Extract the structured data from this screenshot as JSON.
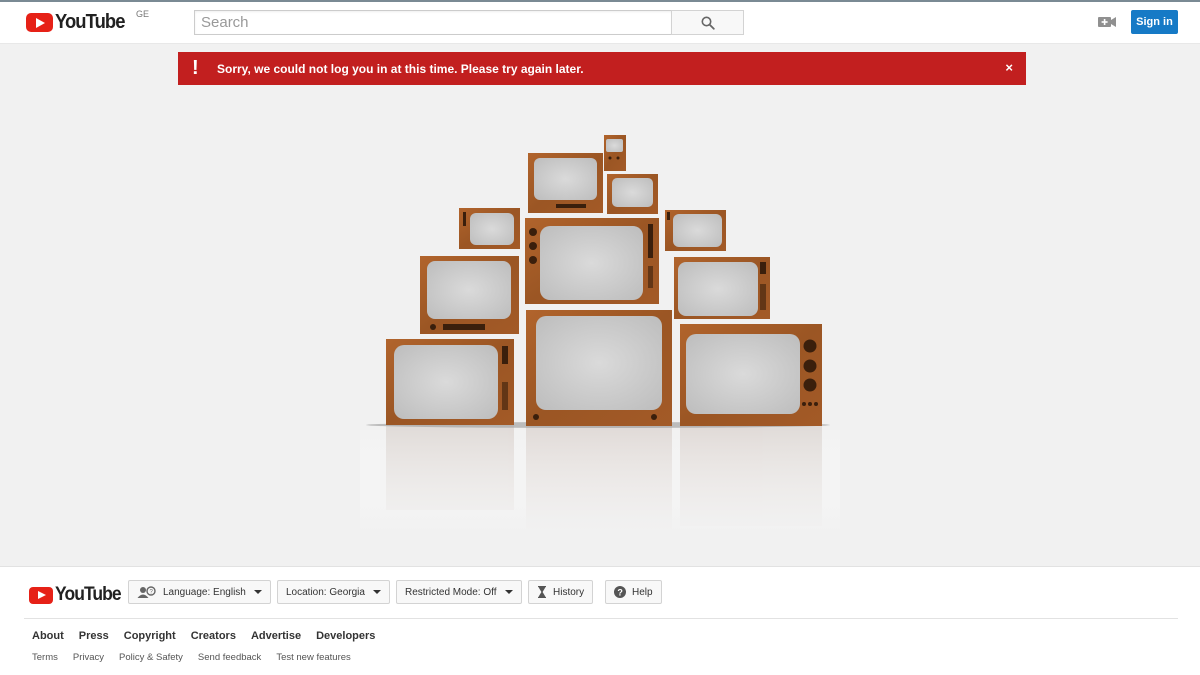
{
  "header": {
    "logo_text": "YouTube",
    "country_code": "GE",
    "search_placeholder": "Search",
    "sign_in_label": "Sign in"
  },
  "alert": {
    "message": "Sorry, we could not log you in at this time. Please try again later.",
    "icon": "exclamation-icon",
    "close_glyph": "×",
    "color": "#c21f1f"
  },
  "footer": {
    "logo_text": "YouTube",
    "language_button": "Language: English",
    "location_button": "Location: Georgia",
    "restricted_button": "Restricted Mode: Off",
    "history_button": "History",
    "help_button": "Help",
    "primary_links": [
      "About",
      "Press",
      "Copyright",
      "Creators",
      "Advertise",
      "Developers"
    ],
    "secondary_links": [
      "Terms",
      "Privacy",
      "Policy & Safety",
      "Send feedback",
      "Test new features"
    ]
  },
  "colors": {
    "brand_red": "#e62117",
    "sign_in_blue": "#167ac6",
    "page_bg": "#f1f1f1"
  }
}
